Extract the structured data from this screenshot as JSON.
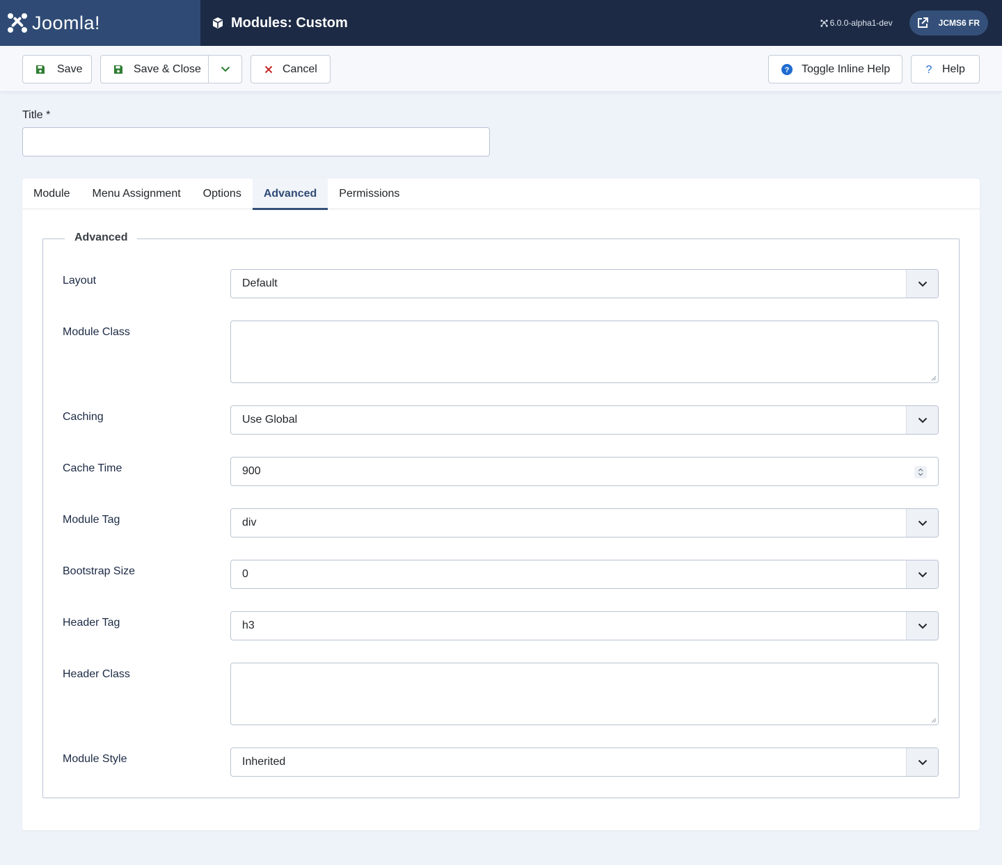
{
  "header": {
    "brand": "Joomla!",
    "page_title": "Modules: Custom",
    "version": "6.0.0-alpha1-dev",
    "site_button": "JCMS6 FR",
    "colors": {
      "header_bg": "#1c2a45",
      "logo_bg": "#2f4b75",
      "accent": "#34507a"
    }
  },
  "toolbar": {
    "save": "Save",
    "save_close": "Save & Close",
    "cancel": "Cancel",
    "toggle_help": "Toggle Inline Help",
    "help": "Help"
  },
  "title_field": {
    "label": "Title *",
    "value": ""
  },
  "tabs": [
    {
      "label": "Module",
      "active": false
    },
    {
      "label": "Menu Assignment",
      "active": false
    },
    {
      "label": "Options",
      "active": false
    },
    {
      "label": "Advanced",
      "active": true
    },
    {
      "label": "Permissions",
      "active": false
    }
  ],
  "advanced": {
    "legend": "Advanced",
    "fields": {
      "layout": {
        "label": "Layout",
        "value": "Default"
      },
      "module_class": {
        "label": "Module Class",
        "value": ""
      },
      "caching": {
        "label": "Caching",
        "value": "Use Global"
      },
      "cache_time": {
        "label": "Cache Time",
        "value": "900"
      },
      "module_tag": {
        "label": "Module Tag",
        "value": "div"
      },
      "bootstrap_size": {
        "label": "Bootstrap Size",
        "value": "0"
      },
      "header_tag": {
        "label": "Header Tag",
        "value": "h3"
      },
      "header_class": {
        "label": "Header Class",
        "value": ""
      },
      "module_style": {
        "label": "Module Style",
        "value": "Inherited"
      }
    }
  }
}
